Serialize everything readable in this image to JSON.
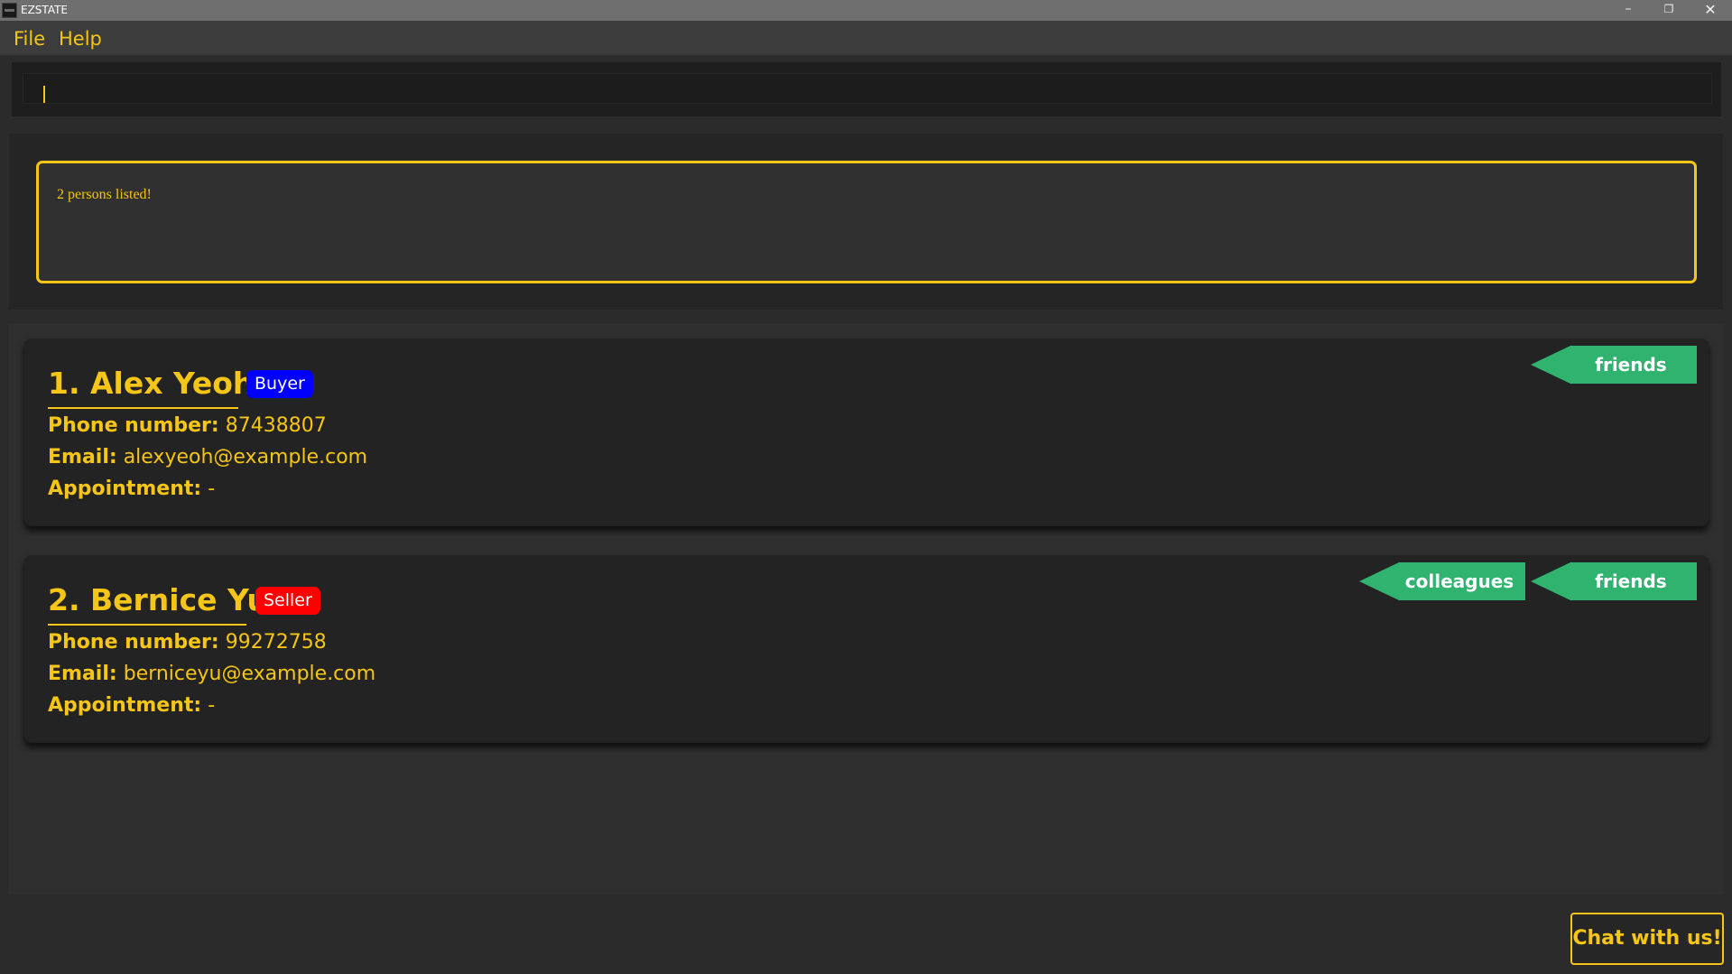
{
  "window": {
    "title": "EZSTATE",
    "controls": {
      "minimize": "–",
      "restore": "❐",
      "close": "✕"
    }
  },
  "menu": {
    "items": [
      {
        "label": "File"
      },
      {
        "label": "Help"
      }
    ]
  },
  "command_box": {
    "value": ""
  },
  "result": {
    "message": "2 persons listed!"
  },
  "persons": [
    {
      "index": "1.",
      "name": "Alex Yeoh",
      "role": "Buyer",
      "phone_label": "Phone number:",
      "phone": "87438807",
      "email_label": "Email:",
      "email": "alexyeoh@example.com",
      "appointment_label": "Appointment:",
      "appointment": "-",
      "tags": [
        "friends"
      ]
    },
    {
      "index": "2.",
      "name": "Bernice Yu",
      "role": "Seller",
      "phone_label": "Phone number:",
      "phone": "99272758",
      "email_label": "Email:",
      "email": "berniceyu@example.com",
      "appointment_label": "Appointment:",
      "appointment": "-",
      "tags": [
        "colleagues",
        "friends"
      ]
    }
  ],
  "chat_button": {
    "label": "Chat with us!"
  },
  "colors": {
    "accent": "#f5c518",
    "buyer_badge": "#0000ff",
    "seller_badge": "#ff0000",
    "tag": "#2fb36f"
  }
}
